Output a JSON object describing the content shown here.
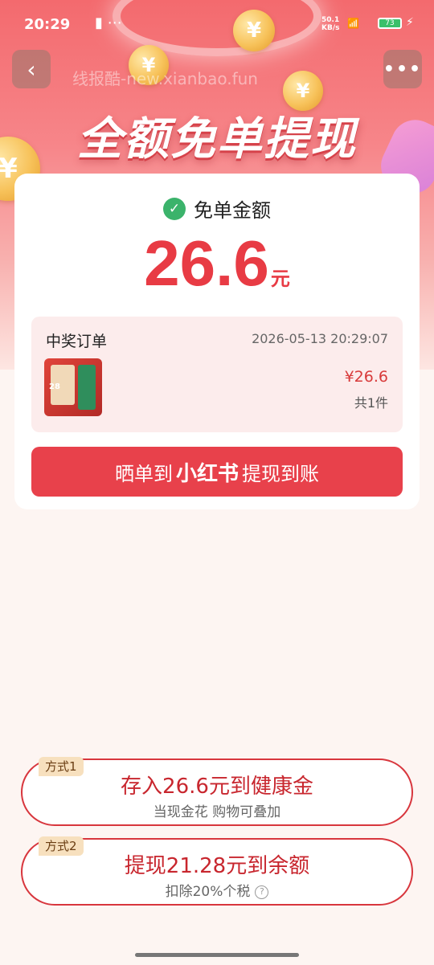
{
  "status_bar": {
    "time": "20:29",
    "network_speed_value": "50.1",
    "network_speed_unit": "KB/s",
    "signal": "5G",
    "battery": "73"
  },
  "watermark": "线报酷-new.xianbao.fun",
  "hero": {
    "title": "全额免单提现",
    "coin_symbol": "¥"
  },
  "card": {
    "amount_label": "免单金额",
    "amount_value": "26.6",
    "amount_unit": "元",
    "order": {
      "title": "中奖订单",
      "time": "2026-05-13 20:29:07",
      "price": "¥26.6",
      "count": "共1件",
      "thumb_tag": "28"
    },
    "share_button": {
      "prefix": "晒单到",
      "brand": "小红书",
      "suffix": "提现到账"
    }
  },
  "options": [
    {
      "badge": "方式1",
      "main": "存入26.6元到健康金",
      "sub": "当现金花 购物可叠加"
    },
    {
      "badge": "方式2",
      "main": "提现21.28元到余额",
      "sub": "扣除20%个税"
    }
  ],
  "colors": {
    "accent": "#e8414b",
    "amount": "#e83b44",
    "success": "#3bb36b"
  },
  "icons": {
    "back": "chevron-left-icon",
    "more": "more-horizontal-icon",
    "check": "check-circle-icon",
    "help": "question-circle-icon"
  }
}
